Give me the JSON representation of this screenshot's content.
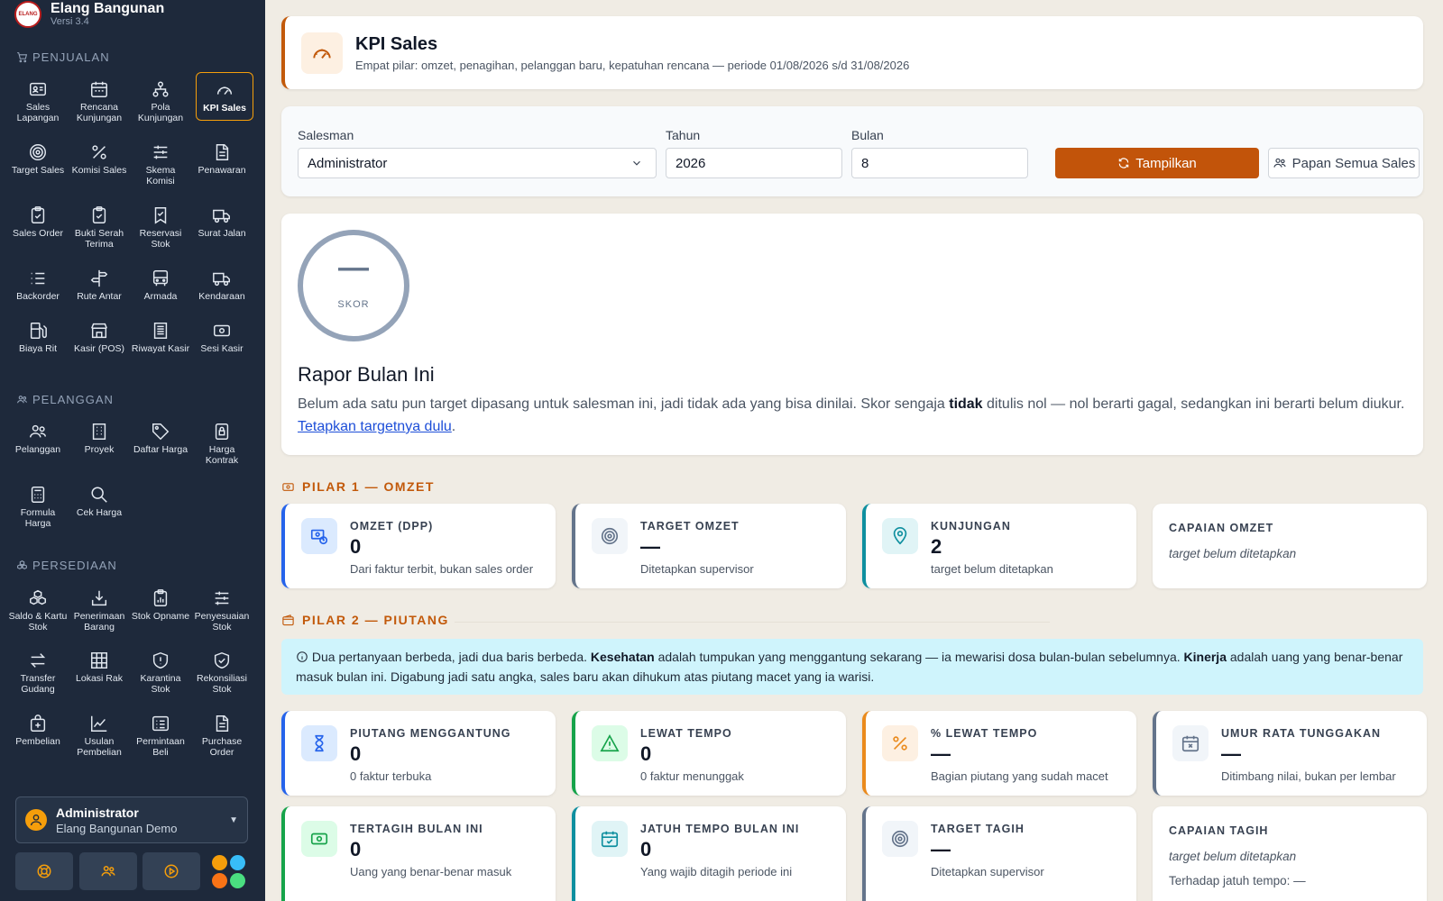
{
  "app": {
    "name": "Elang Bangunan",
    "version": "Versi 3.4",
    "logo_text": "ELANG"
  },
  "sidebar": {
    "penjualan": {
      "title": "PENJUALAN",
      "items": [
        "Sales Lapangan",
        "Rencana Kunjungan",
        "Pola Kunjungan",
        "KPI Sales",
        "Target Sales",
        "Komisi Sales",
        "Skema Komisi",
        "Penawaran",
        "Sales Order",
        "Bukti Serah Terima",
        "Reservasi Stok",
        "Surat Jalan",
        "Backorder",
        "Rute Antar",
        "Armada",
        "Kendaraan",
        "Biaya Rit",
        "Kasir (POS)",
        "Riwayat Kasir",
        "Sesi Kasir"
      ]
    },
    "pelanggan": {
      "title": "PELANGGAN",
      "items": [
        "Pelanggan",
        "Proyek",
        "Daftar Harga",
        "Harga Kontrak",
        "Formula Harga",
        "Cek Harga"
      ]
    },
    "persediaan": {
      "title": "PERSEDIAAN",
      "items": [
        "Saldo & Kartu Stok",
        "Penerimaan Barang",
        "Stok Opname",
        "Penyesuaian Stok",
        "Transfer Gudang",
        "Lokasi Rak",
        "Karantina Stok",
        "Rekonsiliasi Stok",
        "Pembelian",
        "Usulan Pembelian",
        "Permintaan Beli",
        "Purchase Order"
      ]
    },
    "active_item": "KPI Sales"
  },
  "user": {
    "name": "Administrator",
    "org": "Elang Bangunan Demo"
  },
  "colors": {
    "accent": "#c2590a",
    "sidebar_bg": "#1e293b",
    "blue": "#2563eb",
    "green": "#16a34a",
    "orange": "#ea8a1c",
    "teal": "#0e8f9f",
    "slate": "#64748b"
  },
  "header": {
    "title": "KPI Sales",
    "subtitle": "Empat pilar: omzet, penagihan, pelanggan baru, kepatuhan rencana — periode 01/08/2026 s/d 31/08/2026"
  },
  "filters": {
    "salesman_label": "Salesman",
    "salesman_value": "Administrator",
    "tahun_label": "Tahun",
    "tahun_value": "2026",
    "bulan_label": "Bulan",
    "bulan_value": "8",
    "show_button": "Tampilkan",
    "board_button": "Papan Semua Sales"
  },
  "rapor": {
    "score": "—",
    "score_label": "SKOR",
    "title": "Rapor Bulan Ini",
    "text_1": "Belum ada satu pun target dipasang untuk salesman ini, jadi tidak ada yang bisa dinilai. Skor sengaja ",
    "text_bold": "tidak",
    "text_2": " ditulis nol — nol berarti gagal, sedangkan ini berarti belum diukur. ",
    "link": "Tetapkan targetnya dulu",
    "text_3": "."
  },
  "pilar1": {
    "title": "PILAR 1 — OMZET",
    "omzet": {
      "label": "OMZET (DPP)",
      "value": "0",
      "sub": "Dari faktur terbit, bukan sales order"
    },
    "target": {
      "label": "TARGET OMZET",
      "value": "—",
      "sub": "Ditetapkan supervisor"
    },
    "kunjungan": {
      "label": "KUNJUNGAN",
      "value": "2",
      "sub": "target belum ditetapkan"
    },
    "capaian": {
      "label": "CAPAIAN OMZET",
      "note": "target belum ditetapkan"
    }
  },
  "pilar2": {
    "title": "PILAR 2 — PIUTANG",
    "info": {
      "t1": " Dua pertanyaan berbeda, jadi dua baris berbeda. ",
      "b1": "Kesehatan",
      "t2": " adalah tumpukan yang menggantung sekarang — ia mewarisi dosa bulan-bulan sebelumnya. ",
      "b2": "Kinerja",
      "t3": " adalah uang yang benar-benar masuk bulan ini. Digabung jadi satu angka, sales baru akan dihukum atas piutang macet yang ia warisi."
    },
    "piutang": {
      "label": "PIUTANG MENGGANTUNG",
      "value": "0",
      "sub": "0 faktur terbuka"
    },
    "lewat": {
      "label": "LEWAT TEMPO",
      "value": "0",
      "sub": "0 faktur menunggak"
    },
    "persen": {
      "label": "% LEWAT TEMPO",
      "value": "—",
      "sub": "Bagian piutang yang sudah macet"
    },
    "umur": {
      "label": "UMUR RATA TUNGGAKAN",
      "value": "—",
      "sub": "Ditimbang nilai, bukan per lembar"
    },
    "tertagih": {
      "label": "TERTAGIH BULAN INI",
      "value": "0",
      "sub": "Uang yang benar-benar masuk"
    },
    "jatuh": {
      "label": "JATUH TEMPO BULAN INI",
      "value": "0",
      "sub": "Yang wajib ditagih periode ini"
    },
    "target": {
      "label": "TARGET TAGIH",
      "value": "—",
      "sub": "Ditetapkan supervisor"
    },
    "capaian": {
      "label": "CAPAIAN TAGIH",
      "note": "target belum ditetapkan",
      "sub": "Terhadap jatuh tempo: —"
    }
  }
}
